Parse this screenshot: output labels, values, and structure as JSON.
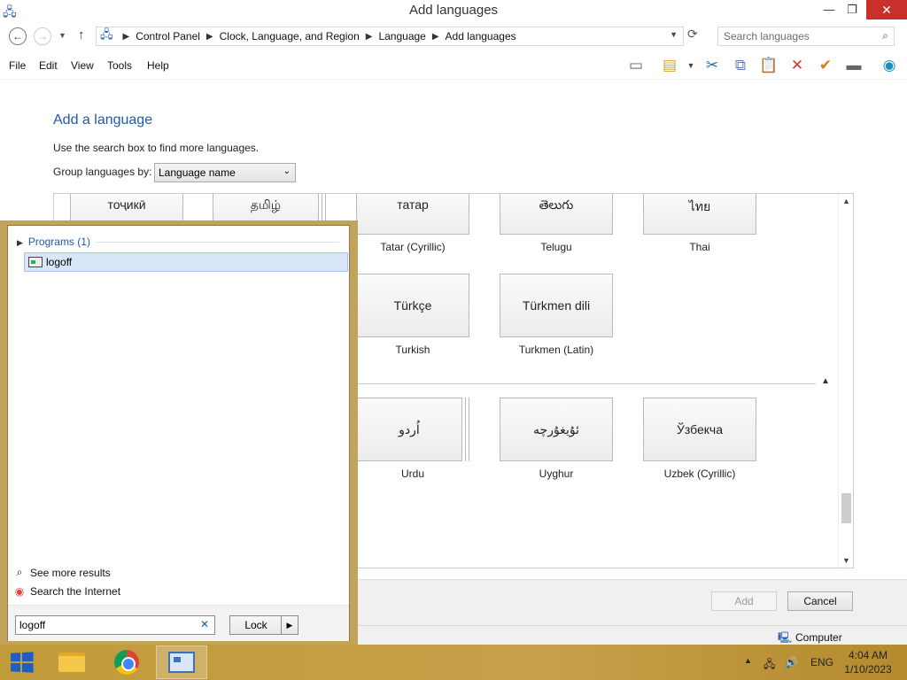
{
  "window": {
    "title": "Add languages",
    "min_glyph": "—",
    "max_glyph": "❐",
    "close_glyph": "✕"
  },
  "address": {
    "crumbs": [
      "Control Panel",
      "Clock, Language, and Region",
      "Language",
      "Add languages"
    ],
    "search_placeholder": "Search languages"
  },
  "menu": [
    "File",
    "Edit",
    "View",
    "Tools",
    "Help"
  ],
  "content": {
    "heading": "Add a language",
    "hint": "Use the search box to find more languages.",
    "group_label": "Group languages by:",
    "group_value": "Language name"
  },
  "languages": {
    "row_top": [
      {
        "native": "тоҷикӣ",
        "name": ""
      },
      {
        "native": "தமிழ்",
        "name": ""
      },
      {
        "native": "татар",
        "name": "Tatar (Cyrillic)"
      },
      {
        "native": "తెలుగు",
        "name": "Telugu"
      },
      {
        "native": "ไทย",
        "name": "Thai"
      }
    ],
    "row_t": [
      {
        "native": "Türkçe",
        "name": "Turkish"
      },
      {
        "native": "Türkmen dili",
        "name": "Turkmen (Latin)"
      }
    ],
    "row_u": [
      {
        "native": "اُردو",
        "name": "Urdu"
      },
      {
        "native": "ئۇيغۇرچە",
        "name": "Uyghur"
      },
      {
        "native": "Ўзбекча",
        "name": "Uzbek (Cyrillic)"
      }
    ]
  },
  "buttons": {
    "add": "Add",
    "cancel": "Cancel"
  },
  "status": {
    "computer": "Computer"
  },
  "flyout": {
    "group_header": "Programs (1)",
    "result": "logoff",
    "see_more": "See more results",
    "search_internet": "Search the Internet",
    "search_value": "logoff",
    "lock_label": "Lock"
  },
  "taskbar": {
    "lang": "ENG",
    "time": "4:04 AM",
    "date": "1/10/2023"
  }
}
